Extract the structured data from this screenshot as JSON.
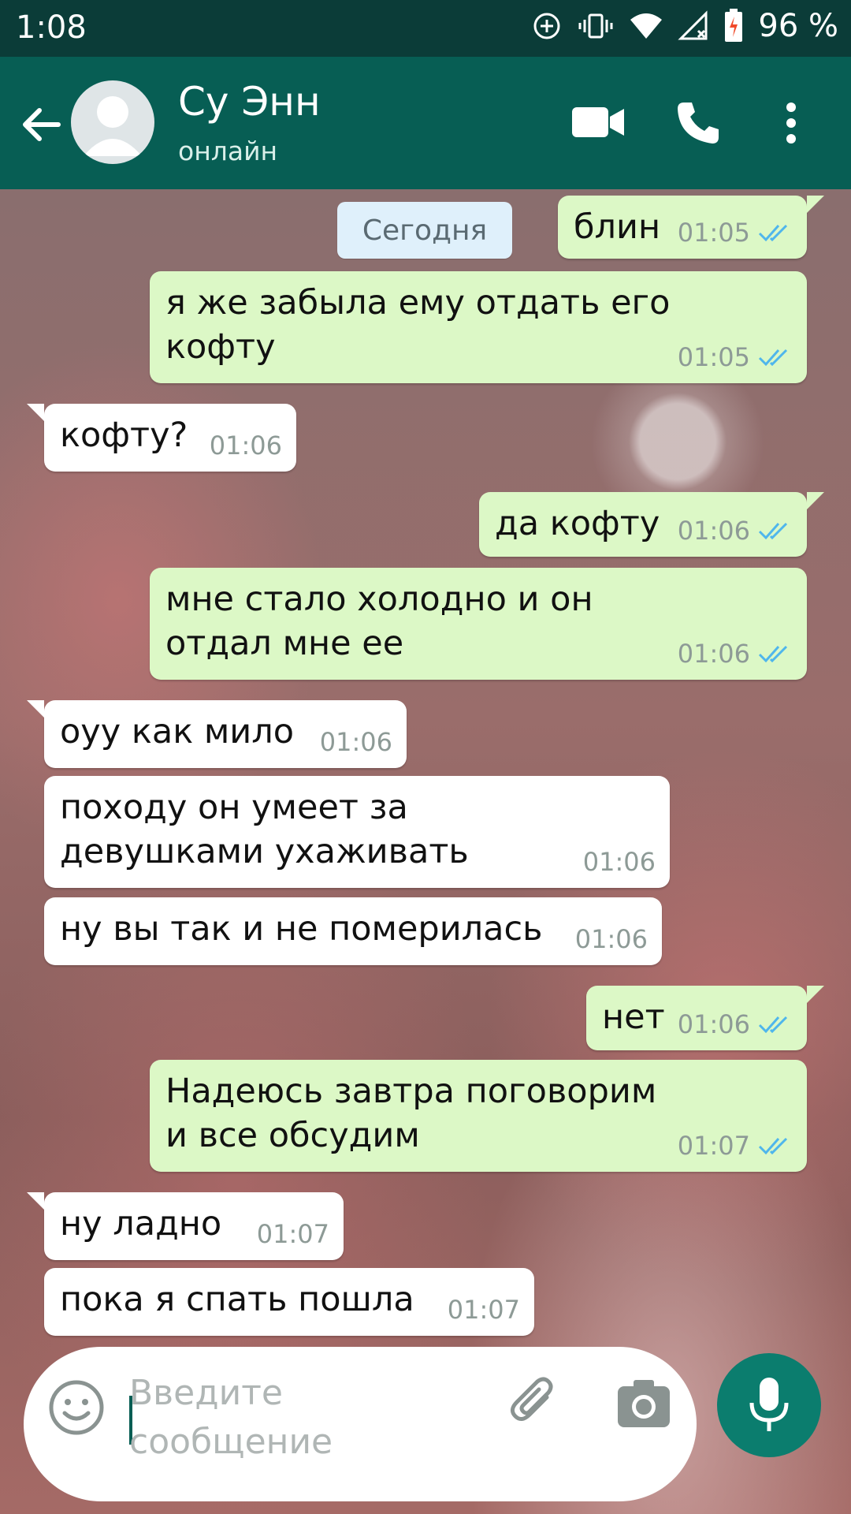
{
  "status_bar": {
    "time": "1:08",
    "battery": "96 %"
  },
  "header": {
    "contact_name": "Су Энн",
    "contact_status": "онлайн",
    "icons": [
      "back-arrow-icon",
      "avatar",
      "video-call-icon",
      "phone-icon",
      "more-vert-icon"
    ]
  },
  "chat": {
    "date_label": "Сегодня",
    "messages": [
      {
        "dir": "out",
        "text": "блин",
        "time": "01:05"
      },
      {
        "dir": "out",
        "text": "я же забыла ему отдать его\nкофту",
        "time": "01:05"
      },
      {
        "dir": "in",
        "text": "кофту?",
        "time": "01:06"
      },
      {
        "dir": "out",
        "text": "да кофту",
        "time": "01:06"
      },
      {
        "dir": "out",
        "text": "мне стало холодно и он\nотдал мне ее",
        "time": "01:06"
      },
      {
        "dir": "in",
        "text": "оуу как мило",
        "time": "01:06"
      },
      {
        "dir": "in",
        "text": "походу он умеет за\nдевушками ухаживать",
        "time": "01:06"
      },
      {
        "dir": "in",
        "text": "ну вы так и не померилась",
        "time": "01:06"
      },
      {
        "dir": "out",
        "text": "нет",
        "time": "01:06"
      },
      {
        "dir": "out",
        "text": "Надеюсь завтра поговорим\nи все обсудим",
        "time": "01:07"
      },
      {
        "dir": "in",
        "text": "ну ладно",
        "time": "01:07"
      },
      {
        "dir": "in",
        "text": "пока я спать пошла",
        "time": "01:07"
      }
    ]
  },
  "composer": {
    "placeholder": "Введите\nсообщение"
  },
  "colors": {
    "header": "#075e54",
    "outgoing": "#dcf8c6",
    "incoming": "#ffffff",
    "read_ticks": "#4fb6ec"
  }
}
